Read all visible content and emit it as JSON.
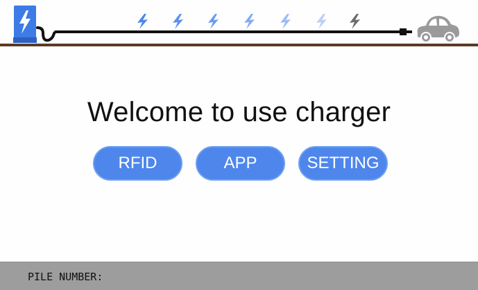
{
  "title": "Welcome to use charger",
  "buttons": {
    "rfid": "RFID",
    "app": "APP",
    "setting": "SETTING"
  },
  "footer": {
    "pile_number_label": "PILE NUMBER:",
    "pile_number_value": ""
  },
  "colors": {
    "button_fill": "#4e86ec",
    "button_border": "#6fa1f2",
    "station_blue": "#3d7be6",
    "bolt_blue": "#5a8ff0",
    "car_gray": "#9a9a9a",
    "ground_brown": "#5a3a24",
    "footer_gray": "#9d9d9d"
  },
  "icons": {
    "station": "charging-station-icon",
    "bolts": [
      "lightning-bolt-icon",
      "lightning-bolt-icon",
      "lightning-bolt-icon",
      "lightning-bolt-icon",
      "lightning-bolt-icon",
      "lightning-bolt-icon",
      "lightning-bolt-icon"
    ],
    "vehicle": "electric-car-icon"
  }
}
